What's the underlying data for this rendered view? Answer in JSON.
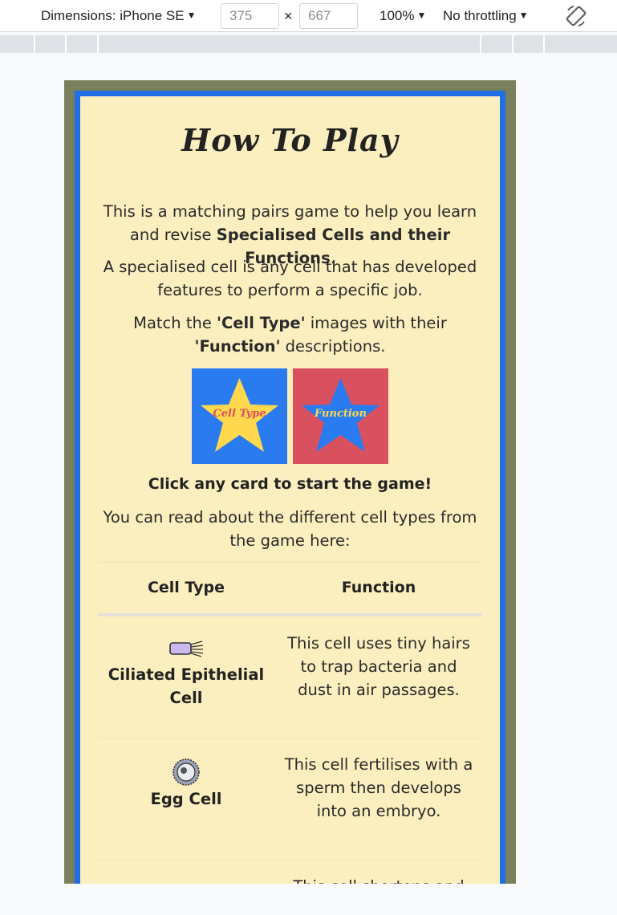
{
  "devtools": {
    "dimensions_label": "Dimensions: iPhone SE",
    "width_value": "375",
    "height_value": "667",
    "times_symbol": "×",
    "zoom": "100%",
    "throttling": "No throttling"
  },
  "game": {
    "title": "How To Play",
    "intro_part1": "This is a matching pairs game to help you learn and revise ",
    "intro_bold": "Specialised Cells and their Functions",
    "intro_part2": ".",
    "definition": "A specialised cell is any cell that has developed features to perform a specific job.",
    "match_part1": "Match the ",
    "match_bold1": "'Cell Type'",
    "match_part2": " images with their ",
    "match_bold2": "'Function'",
    "match_part3": " descriptions.",
    "card_cell_type_label": "Cell Type",
    "card_function_label": "Function",
    "cta": "Click any card to start the game!",
    "read_more": "You can read about the different cell types from the game here:"
  },
  "table": {
    "header_cell_type": "Cell Type",
    "header_function": "Function",
    "rows": [
      {
        "name": "Ciliated Epithelial Cell",
        "function": "This cell uses tiny hairs to trap bacteria and dust in air passages."
      },
      {
        "name": "Egg Cell",
        "function": "This cell fertilises with a sperm then develops into an embryo."
      },
      {
        "name": "",
        "function": "This cell shortens and"
      }
    ]
  },
  "colors": {
    "card_bg": "#fcefbf",
    "frame_blue": "#1f6fe6",
    "frame_olive": "#7a805d",
    "card_blue": "#2a7bf0",
    "card_red": "#d9505f",
    "star_yellow": "#ffd84d"
  }
}
